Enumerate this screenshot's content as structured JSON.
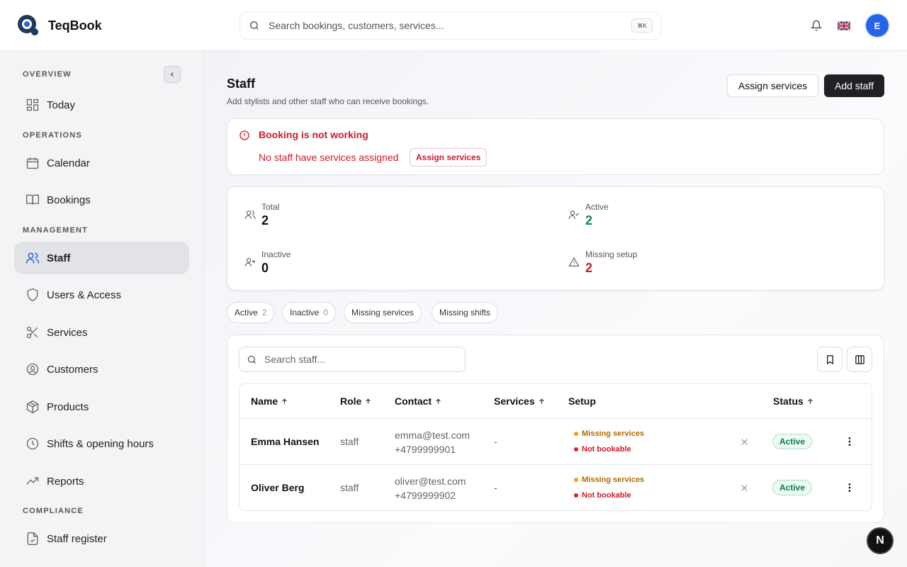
{
  "app": {
    "name": "TeqBook"
  },
  "search": {
    "placeholder": "Search bookings, customers, services...",
    "shortcut": "⌘K"
  },
  "user": {
    "initial": "E"
  },
  "sidebar": {
    "sections": {
      "overview": "OVERVIEW",
      "operations": "OPERATIONS",
      "management": "MANAGEMENT",
      "compliance": "COMPLIANCE"
    },
    "items": [
      {
        "label": "Today",
        "icon": "dashboard-icon"
      },
      {
        "label": "Calendar",
        "icon": "calendar-icon"
      },
      {
        "label": "Bookings",
        "icon": "book-icon"
      },
      {
        "label": "Staff",
        "icon": "users-icon",
        "active": true
      },
      {
        "label": "Users & Access",
        "icon": "shield-icon"
      },
      {
        "label": "Services",
        "icon": "scissors-icon"
      },
      {
        "label": "Customers",
        "icon": "user-circle-icon"
      },
      {
        "label": "Products",
        "icon": "package-icon"
      },
      {
        "label": "Shifts & opening hours",
        "icon": "clock-icon"
      },
      {
        "label": "Reports",
        "icon": "trending-icon"
      },
      {
        "label": "Staff register",
        "icon": "file-check-icon"
      }
    ]
  },
  "page": {
    "title": "Staff",
    "subtitle": "Add stylists and other staff who can receive bookings.",
    "assign_label": "Assign services",
    "add_label": "Add staff"
  },
  "alert": {
    "title": "Booking is not working",
    "text": "No staff have services assigned",
    "action": "Assign services"
  },
  "stats": {
    "total_label": "Total",
    "total": "2",
    "active_label": "Active",
    "active": "2",
    "inactive_label": "Inactive",
    "inactive": "0",
    "missing_label": "Missing setup",
    "missing": "2"
  },
  "filters": [
    {
      "label": "Active",
      "count": "2"
    },
    {
      "label": "Inactive",
      "count": "0"
    },
    {
      "label": "Missing services",
      "count": ""
    },
    {
      "label": "Missing shifts",
      "count": ""
    }
  ],
  "table": {
    "search_placeholder": "Search staff...",
    "headers": {
      "name": "Name",
      "role": "Role",
      "contact": "Contact",
      "services": "Services",
      "setup": "Setup",
      "status": "Status"
    },
    "rows": [
      {
        "name": "Emma Hansen",
        "role": "staff",
        "email": "emma@test.com",
        "phone": "+4799999901",
        "services": "-",
        "setup1": "Missing services",
        "setup2": "Not bookable",
        "status": "Active"
      },
      {
        "name": "Oliver Berg",
        "role": "staff",
        "email": "oliver@test.com",
        "phone": "+4799999902",
        "services": "-",
        "setup1": "Missing services",
        "setup2": "Not bookable",
        "status": "Active"
      }
    ]
  },
  "fab": {
    "label": "N"
  },
  "colors": {
    "danger": "#d11a2a",
    "success": "#0f7a45",
    "warning": "#b46a00",
    "accent": "#2563eb"
  }
}
